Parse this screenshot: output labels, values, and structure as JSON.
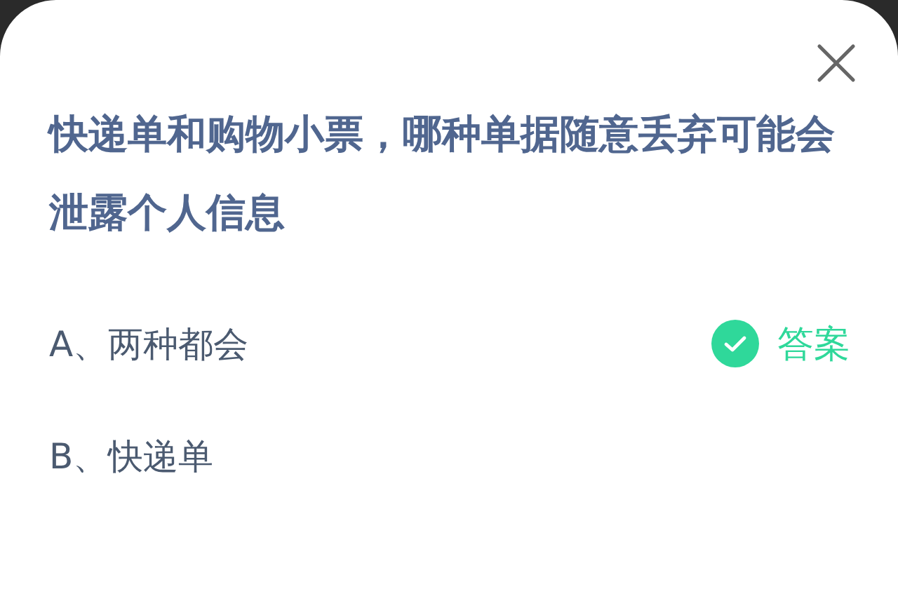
{
  "question": "快递单和购物小票，哪种单据随意丢弃可能会泄露个人信息",
  "answer_label": "答案",
  "options": [
    {
      "text": "A、两种都会",
      "correct": true
    },
    {
      "text": "B、快递单",
      "correct": false
    }
  ]
}
